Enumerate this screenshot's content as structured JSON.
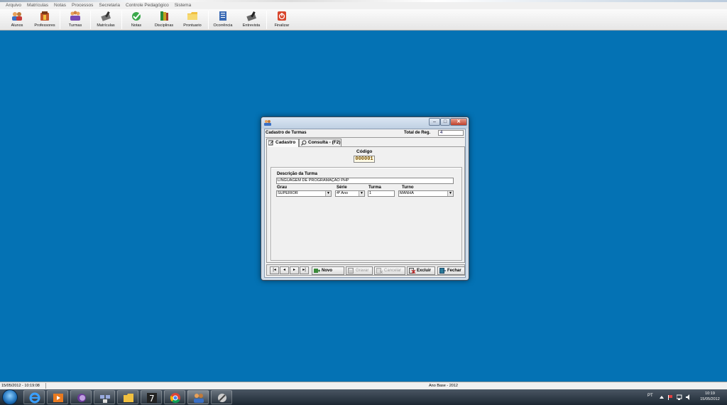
{
  "menu": [
    "Arquivo",
    "Matrículas",
    "Notas",
    "Processos",
    "Secretaria",
    "Controle Pedagógico",
    "Sistema"
  ],
  "toolbar": {
    "alunos": "Alunos",
    "professores": "Professores",
    "turmas": "Turmas",
    "matriculas": "Matrículas",
    "notas": "Notas",
    "disciplinas": "Disciplinas",
    "prontuario": "Prontuario",
    "ocorrencia": "Ocorrência",
    "entrevista": "Entrevista",
    "finalizar": "Finalizar"
  },
  "dialog": {
    "caption_buttons": {
      "minimize": "–",
      "maximize": "□",
      "close": "✕"
    },
    "form_title": "Cadastro de Turmas",
    "total_label": "Total de Reg.",
    "total_value": "4",
    "tabs": {
      "cadastro": "Cadastro",
      "consulta": "Consulta - (F2)"
    },
    "codigo_label": "Código",
    "codigo_value": "000001",
    "descricao_label": "Descrição da Turma",
    "descricao_value": "LINGUAGEM DE PROGRAMAÇÃO PHP",
    "grau_label": "Grau",
    "grau_value": "SUPERIOR",
    "serie_label": "Série",
    "serie_value": "4º Ano",
    "turma_label": "Turma",
    "turma_value": "1",
    "turno_label": "Turno",
    "turno_value": "MANHÃ",
    "nav": {
      "first": "|◂",
      "prev": "◂",
      "next": "▸",
      "last": "▸|"
    },
    "actions": {
      "novo": "Novo",
      "gravar": "Gravar",
      "cancelar": "Cancelar",
      "excluir": "Excluir",
      "fechar": "Fechar"
    }
  },
  "statusbar": {
    "datetime": "15/05/2012 - 10:19:08",
    "ano_base": "Ano Base - 2012"
  },
  "taskbar": {
    "language": "PT",
    "time": "10:19",
    "date": "15/05/2012"
  },
  "colors": {
    "desktop": "#0472b4",
    "toolbar_bg": "#f0f0f0"
  }
}
